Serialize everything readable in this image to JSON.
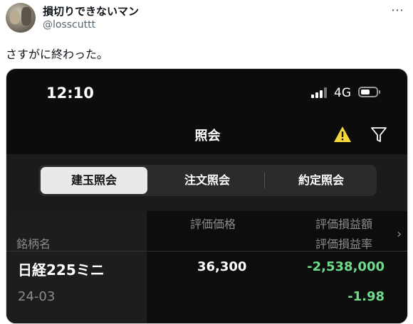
{
  "tweet": {
    "display_name": "損切りできないマン",
    "handle": "@losscuttt",
    "more_icon": "⋯",
    "text": "さすがに終わった。"
  },
  "phone": {
    "status_bar": {
      "time": "12:10",
      "network": "4G"
    },
    "nav": {
      "title": "照会",
      "warning_icon": "warning-icon",
      "filter_icon": "filter-icon"
    },
    "tabs": [
      {
        "label": "建玉照会",
        "active": true
      },
      {
        "label": "注文照会",
        "active": false
      },
      {
        "label": "約定照会",
        "active": false
      }
    ],
    "table": {
      "headers": {
        "name": "銘柄名",
        "price": "評価価格",
        "pnl": "評価損益額",
        "pnl_rate": "評価損益率"
      },
      "rows": [
        {
          "name": "日経225ミニ",
          "contract": "24-03",
          "price": "36,300",
          "pnl": "-2,538,000",
          "pnl_rate": "-1.98"
        }
      ]
    },
    "colors": {
      "negative": "#6fdc8c",
      "warning": "#f5d63d"
    }
  }
}
